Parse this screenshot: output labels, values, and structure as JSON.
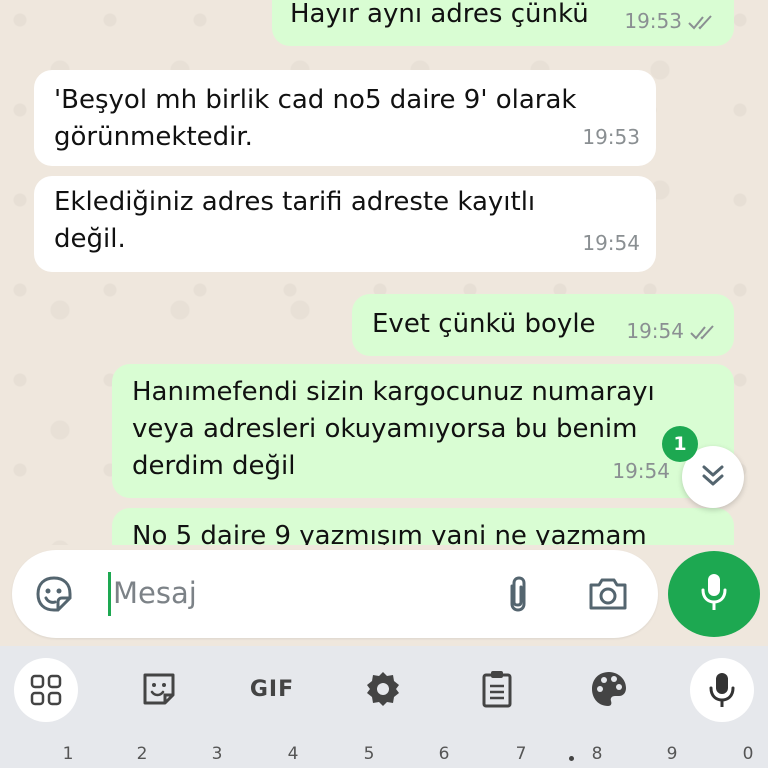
{
  "messages": [
    {
      "direction": "out",
      "text": "Hayır aynı adres çünkü",
      "time": "19:53",
      "status": "read"
    },
    {
      "direction": "in",
      "text": "'Beşyol mh birlik cad no5 daire 9' olarak\ngörünmektedir.",
      "time": "19:53"
    },
    {
      "direction": "in",
      "text": "Eklediğiniz adres tarifi adreste kayıtlı\ndeğil.",
      "time": "19:54"
    },
    {
      "direction": "out",
      "text": "Evet çünkü boyle",
      "time": "19:54",
      "status": "read"
    },
    {
      "direction": "out",
      "text": "Hanımefendi sizin kargocunuz numarayı\nveya adresleri okuyamıyorsa bu benim\nderdim değil",
      "time": "19:54",
      "status": "read"
    },
    {
      "direction": "out",
      "text": "No 5 daire 9 yazmışım yani ne yazmam",
      "time": ""
    }
  ],
  "scroll_down": {
    "unread_count": "1",
    "icon": "double-chevron-down-icon"
  },
  "composer": {
    "placeholder": "Mesaj",
    "emoji_icon": "sticker-smile-icon",
    "attach_icon": "paperclip-icon",
    "camera_icon": "camera-icon",
    "send_icon": "microphone-icon"
  },
  "keyboard": {
    "toolbar": [
      "apps-grid-icon",
      "sticker-icon",
      "GIF",
      "settings-gear-icon",
      "clipboard-icon",
      "palette-icon",
      "microphone-icon"
    ],
    "gif_label": "GIF",
    "number_row": [
      "1",
      "2",
      "3",
      "4",
      "5",
      "6",
      "7",
      "8",
      "9",
      "0"
    ]
  },
  "colors": {
    "accent": "#1da851",
    "outgoing_bubble": "#d9fdd3",
    "incoming_bubble": "#ffffff",
    "wallpaper": "#efe7dd",
    "tick_read": "#8a8f92"
  }
}
